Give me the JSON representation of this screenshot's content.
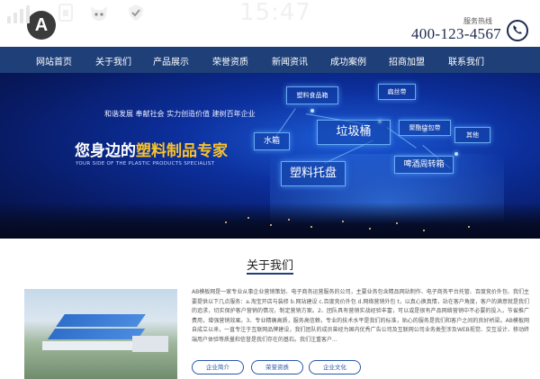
{
  "status_bar": {
    "time": "15:47",
    "icons": [
      "signal-icon",
      "sim-icon",
      "app-icon",
      "shield-icon"
    ]
  },
  "header": {
    "logo_letter": "A",
    "hotline_label": "服务热线",
    "hotline_number": "400-123-4567",
    "phone_icon": "phone-icon"
  },
  "nav": {
    "items": [
      "网站首页",
      "关于我们",
      "产品展示",
      "荣誉资质",
      "新闻资讯",
      "成功案例",
      "招商加盟",
      "联系我们"
    ]
  },
  "banner": {
    "slogan": "和谐发展 奉献社会 实力创造价值 建树百年企业",
    "headline_prefix": "您身边的",
    "headline_highlight": "塑料制品专家",
    "subtitle_en": "YOUR SIDE OF THE PLASTIC PRODUCTS SPECIALIST",
    "cards": [
      "塑料食品箱",
      "扁丝带",
      "垃圾桶",
      "聚酯绕包带",
      "其他",
      "水箱",
      "啤酒周转箱",
      "塑料托盘"
    ]
  },
  "about": {
    "section_title": "关于我们",
    "body": "AB模板网是一家专业从事企业营销策划、电子商务运营服务的公司，主要业务包含精品网站制作、电子商务平台托管、百度竞价外包、我们主要提供以下几点服务：a.淘宝开店与装修 b.网站建设 c.百度竞价外包 d.网络营销外包 t，以真心换真情，站在客户角度，客户的满意就是我们的追求，切实保护客户营销的情况，制定营销方案。2、团队具有营销实战经验丰富，可以或是很有产品网络营销中不必要的投入，节省推广费用，增强营销效果。3、专业精确高质，服务高信赖，专业的技术水平是我们的标准，贴心的服务是我们和客户之间的良好桥梁。AB模板网自成立以来，一直专注于互联网品牌建设，我们团队的成员曾经为国内优秀广告公司及互联网公司业务类型涉及WEB视觉、交互设计、移动终端用户体验等质量和信誉是我们存在的基石。我们注重客户...",
    "buttons": [
      "企业简介",
      "荣誉资质",
      "企业文化"
    ]
  },
  "colors": {
    "nav_bg": "#1e3f78",
    "headline_highlight": "#f8c22a",
    "button_border": "#2a56a8"
  }
}
